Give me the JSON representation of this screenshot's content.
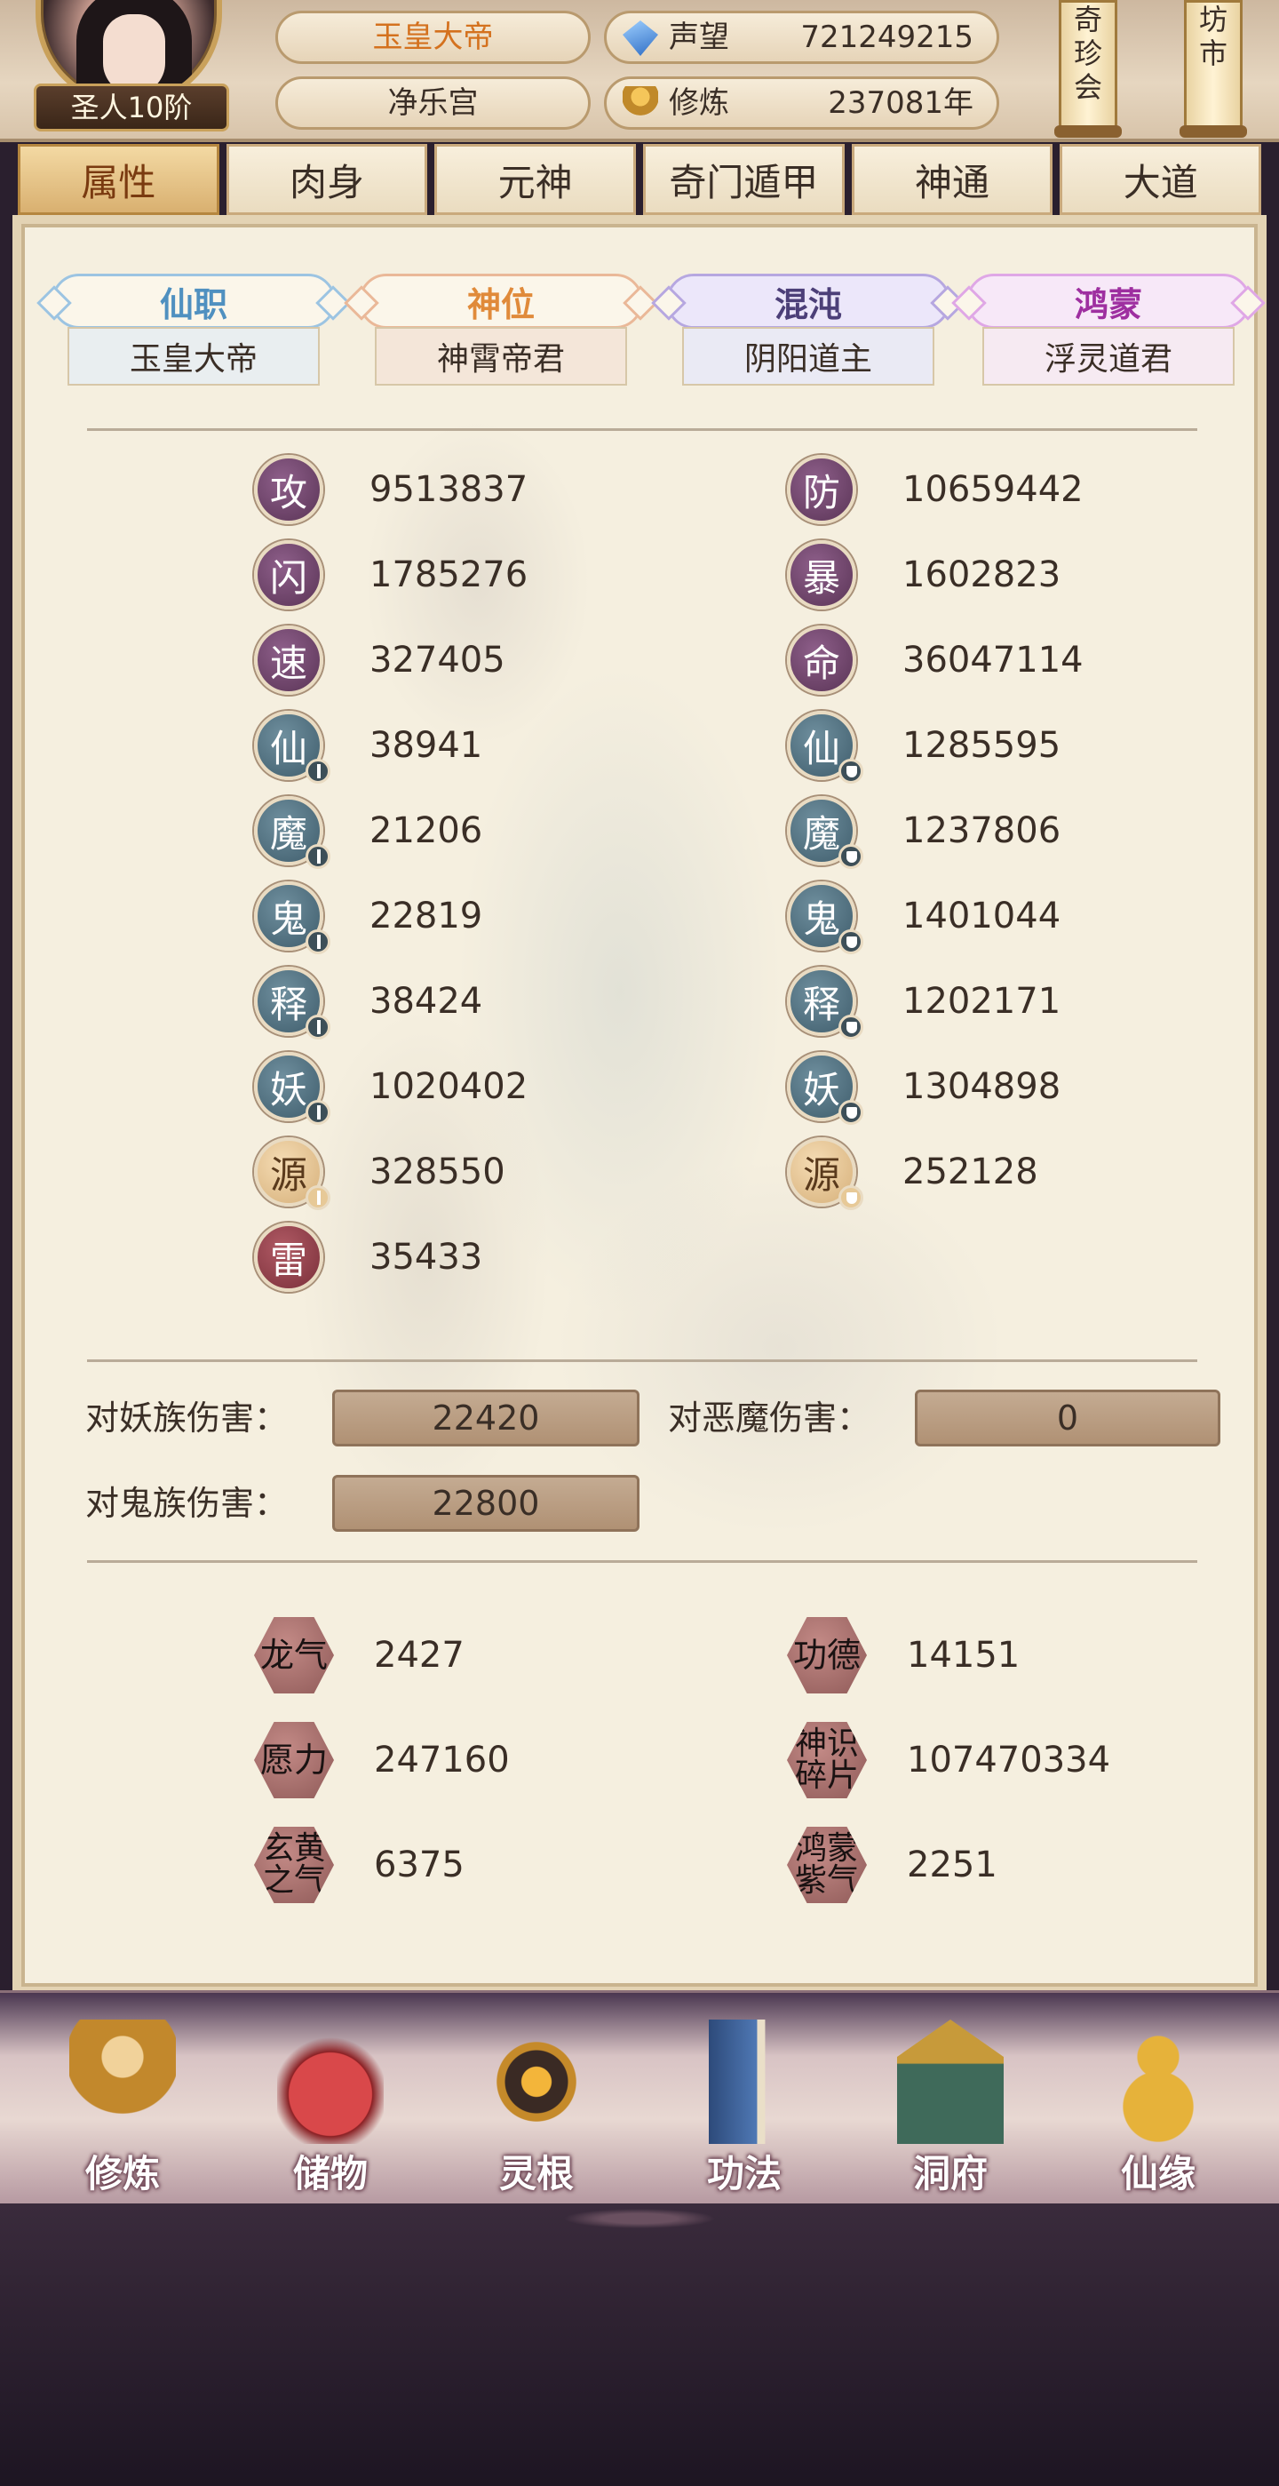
{
  "header": {
    "avatar_rank": "圣人10阶",
    "player_title": "玉皇大帝",
    "palace": "净乐宫",
    "reputation_label": "声望",
    "reputation_value": "721249215",
    "cultivation_label": "修炼",
    "cultivation_value": "237081年",
    "scroll_treasure": [
      "奇",
      "珍",
      "会"
    ],
    "scroll_market": [
      "坊",
      "市"
    ]
  },
  "tabs": [
    {
      "label": "属性",
      "active": true
    },
    {
      "label": "肉身",
      "active": false
    },
    {
      "label": "元神",
      "active": false
    },
    {
      "label": "奇门遁甲",
      "active": false
    },
    {
      "label": "神通",
      "active": false
    },
    {
      "label": "大道",
      "active": false
    }
  ],
  "ranks": [
    {
      "title": "仙职",
      "value": "玉皇大帝"
    },
    {
      "title": "神位",
      "value": "神霄帝君"
    },
    {
      "title": "混沌",
      "value": "阴阳道主"
    },
    {
      "title": "鸿蒙",
      "value": "浮灵道君"
    }
  ],
  "attributes_left": [
    {
      "char": "攻",
      "value": "9513837",
      "style": "purple",
      "sub": ""
    },
    {
      "char": "闪",
      "value": "1785276",
      "style": "purple",
      "sub": ""
    },
    {
      "char": "速",
      "value": "327405",
      "style": "purple",
      "sub": ""
    },
    {
      "char": "仙",
      "value": "38941",
      "style": "teal",
      "sub": "sword"
    },
    {
      "char": "魔",
      "value": "21206",
      "style": "teal",
      "sub": "sword"
    },
    {
      "char": "鬼",
      "value": "22819",
      "style": "teal",
      "sub": "sword"
    },
    {
      "char": "释",
      "value": "38424",
      "style": "teal",
      "sub": "sword"
    },
    {
      "char": "妖",
      "value": "1020402",
      "style": "teal",
      "sub": "sword"
    },
    {
      "char": "源",
      "value": "328550",
      "style": "gold",
      "sub": "sword"
    },
    {
      "char": "雷",
      "value": "35433",
      "style": "red",
      "sub": ""
    }
  ],
  "attributes_right": [
    {
      "char": "防",
      "value": "10659442",
      "style": "purple",
      "sub": ""
    },
    {
      "char": "暴",
      "value": "1602823",
      "style": "purple",
      "sub": ""
    },
    {
      "char": "命",
      "value": "36047114",
      "style": "purple",
      "sub": ""
    },
    {
      "char": "仙",
      "value": "1285595",
      "style": "teal",
      "sub": "shield"
    },
    {
      "char": "魔",
      "value": "1237806",
      "style": "teal",
      "sub": "shield"
    },
    {
      "char": "鬼",
      "value": "1401044",
      "style": "teal",
      "sub": "shield"
    },
    {
      "char": "释",
      "value": "1202171",
      "style": "teal",
      "sub": "shield"
    },
    {
      "char": "妖",
      "value": "1304898",
      "style": "teal",
      "sub": "shield"
    },
    {
      "char": "源",
      "value": "252128",
      "style": "gold",
      "sub": "shield"
    }
  ],
  "damage": {
    "demon_label": "对妖族伤害：",
    "demon_value": "22420",
    "devil_label": "对恶魔伤害：",
    "devil_value": "0",
    "ghost_label": "对鬼族伤害：",
    "ghost_value": "22800"
  },
  "resources": [
    {
      "label": "龙气",
      "value": "2427"
    },
    {
      "label": "功德",
      "value": "14151"
    },
    {
      "label": "愿力",
      "value": "247160"
    },
    {
      "label": "神识碎片",
      "value": "107470334"
    },
    {
      "label": "玄黄之气",
      "value": "6375"
    },
    {
      "label": "鸿蒙紫气",
      "value": "2251"
    }
  ],
  "bottom_nav": [
    {
      "label": "修炼",
      "icon": "monk-icon"
    },
    {
      "label": "储物",
      "icon": "bag-icon"
    },
    {
      "label": "灵根",
      "icon": "spirit-root-icon"
    },
    {
      "label": "功法",
      "icon": "book-icon"
    },
    {
      "label": "洞府",
      "icon": "cave-house-icon"
    },
    {
      "label": "仙缘",
      "icon": "gourd-icon"
    }
  ]
}
